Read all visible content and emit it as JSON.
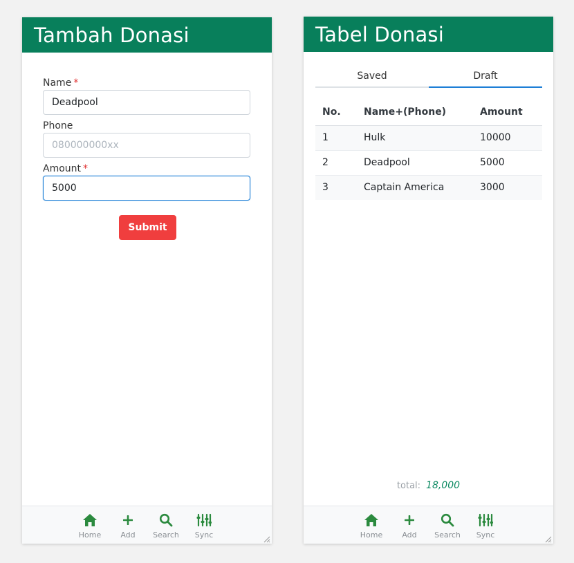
{
  "form_panel": {
    "title": "Tambah Donasi",
    "name_label": "Name",
    "name_value": "Deadpool",
    "phone_label": "Phone",
    "phone_placeholder": "080000000xx",
    "phone_value": "",
    "amount_label": "Amount",
    "amount_value": "5000",
    "required_mark": "*",
    "submit_label": "Submit"
  },
  "table_panel": {
    "title": "Tabel Donasi",
    "tabs": [
      {
        "label": "Saved",
        "active": false
      },
      {
        "label": "Draft",
        "active": true
      }
    ],
    "columns": [
      "No.",
      "Name+(Phone)",
      "Amount"
    ],
    "rows": [
      {
        "no": "1",
        "name": "Hulk",
        "amount": "10000"
      },
      {
        "no": "2",
        "name": "Deadpool",
        "amount": "5000"
      },
      {
        "no": "3",
        "name": "Captain America",
        "amount": "3000"
      }
    ],
    "total_label": "total:",
    "total_value": "18,000"
  },
  "bottom_nav": {
    "items": [
      {
        "label": "Home",
        "icon": "home-icon"
      },
      {
        "label": "Add",
        "icon": "plus-icon"
      },
      {
        "label": "Search",
        "icon": "search-icon"
      },
      {
        "label": "Sync",
        "icon": "sliders-icon"
      }
    ]
  },
  "colors": {
    "header_bg": "#087f5b",
    "icon_green": "#2b8a3e",
    "submit_bg": "#f03e3e",
    "active_tab": "#1c7ed6",
    "required": "#e03131"
  }
}
